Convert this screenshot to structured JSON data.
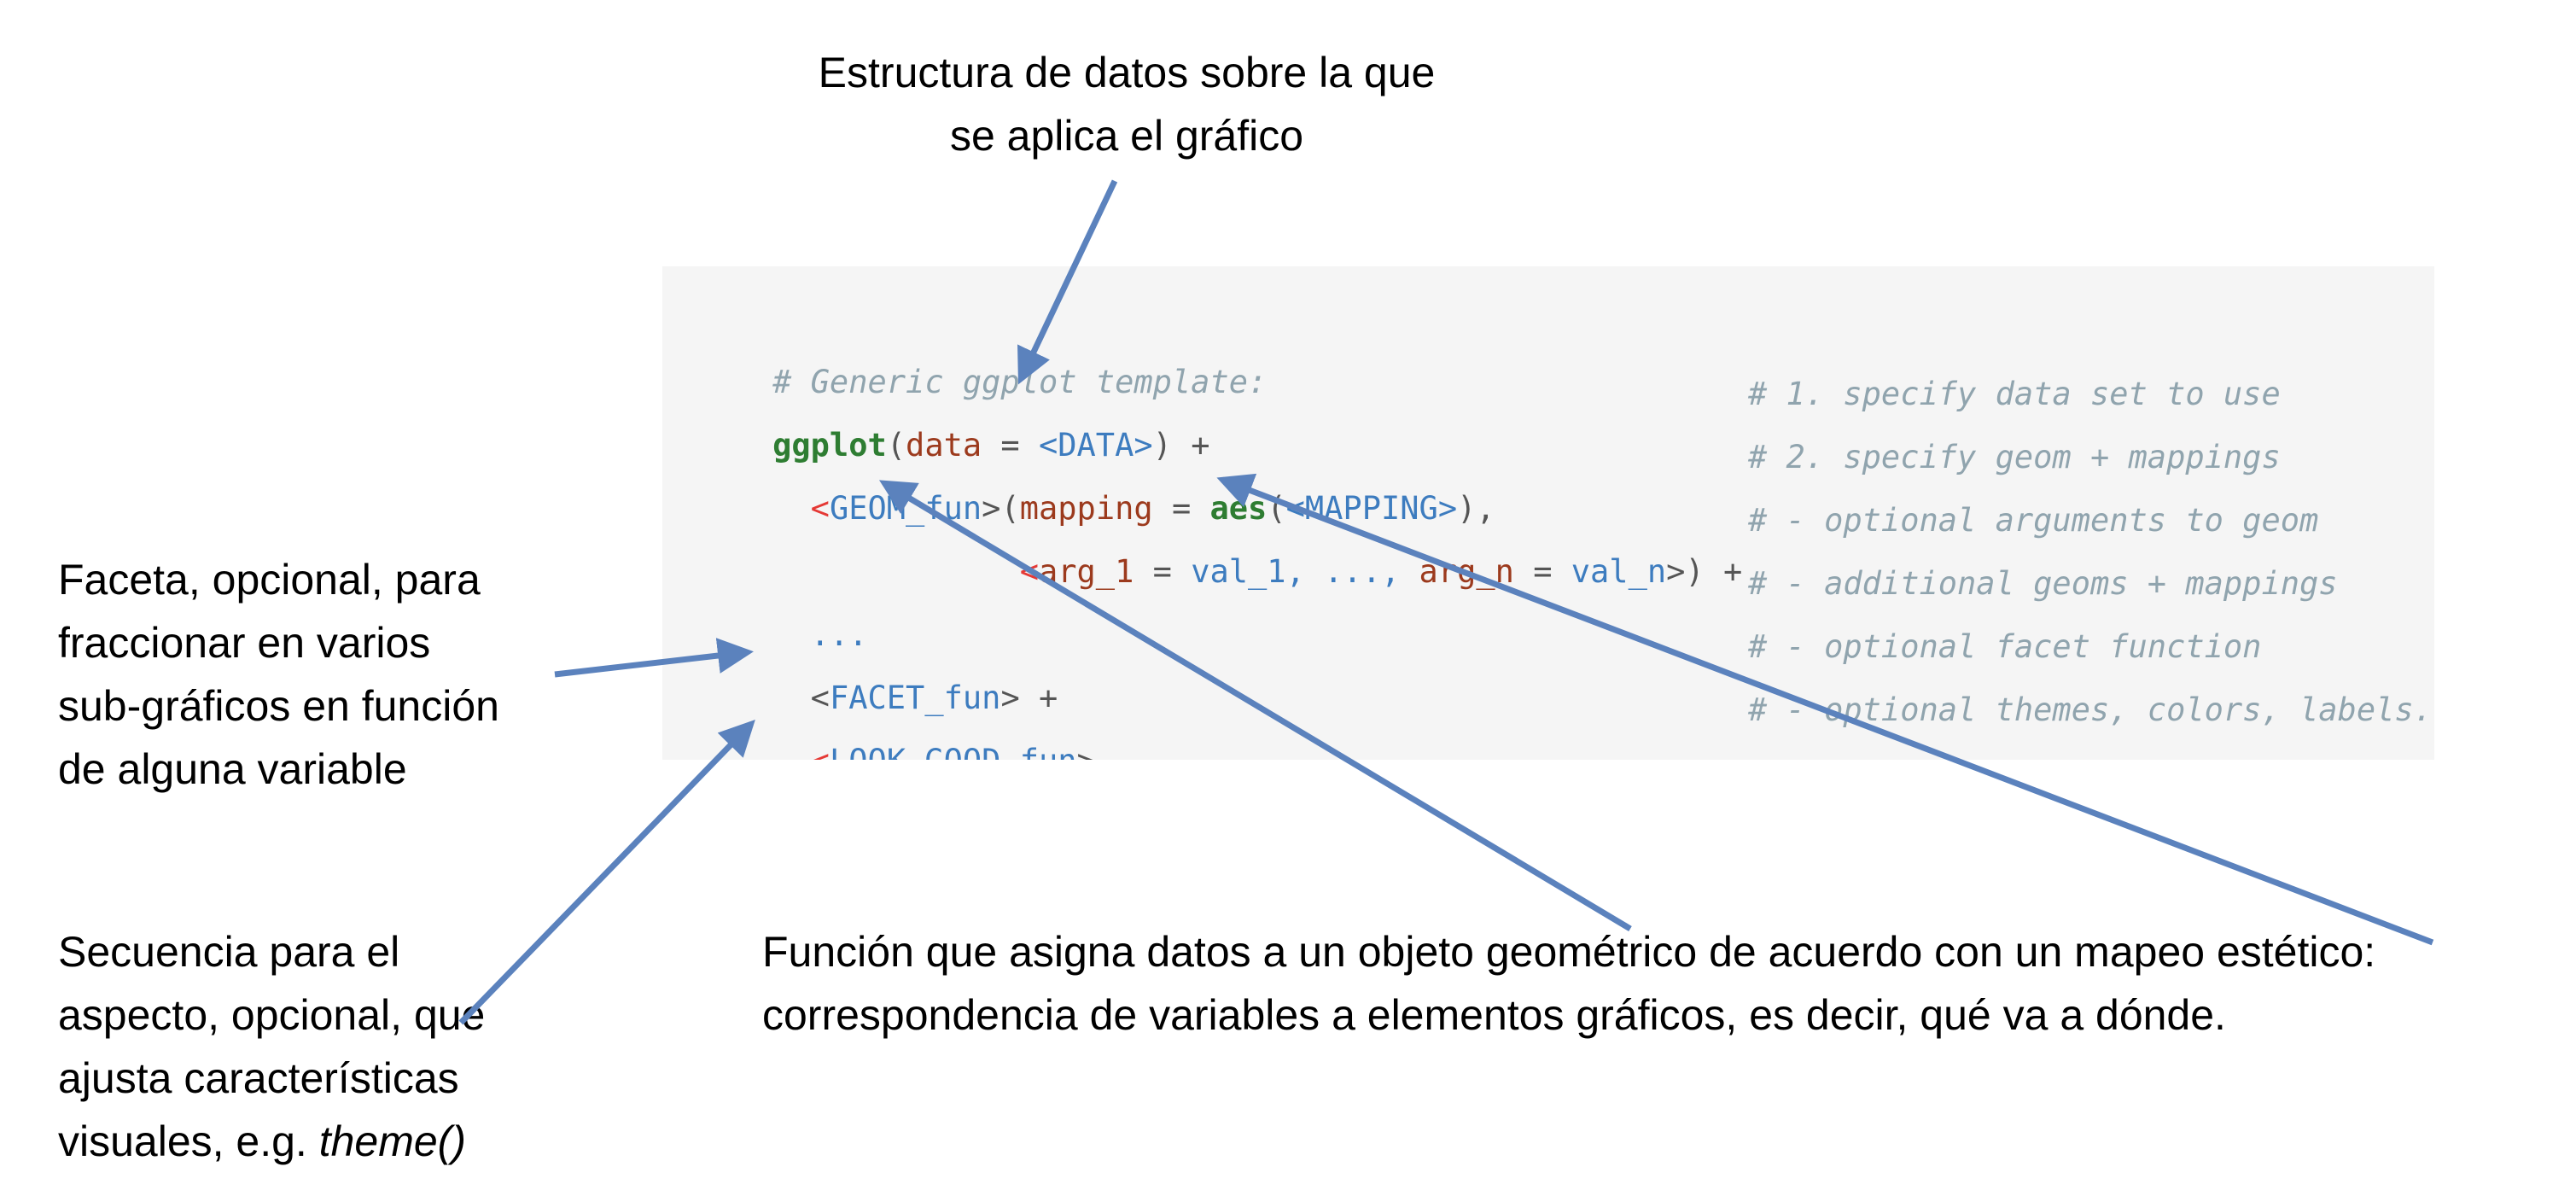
{
  "annotations": {
    "top": {
      "line1": "Estructura de datos sobre la que",
      "line2": "se aplica el gráfico"
    },
    "facet": {
      "line1": "Faceta, opcional, para",
      "line2": "fraccionar en varios",
      "line3": "sub-gráficos en función",
      "line4": "de alguna variable"
    },
    "look": {
      "line1": "Secuencia para el",
      "line2": "aspecto, opcional, que",
      "line3": "ajusta características",
      "line4_prefix": "visuales, e.g. ",
      "line4_italic": "theme()"
    },
    "geom": {
      "line1": "Función que asigna datos a un objeto geométrico de acuerdo con un mapeo estético:",
      "line2": "correspondencia de variables a elementos gráficos, es decir, qué va a dónde."
    }
  },
  "code": {
    "header_comment": "# Generic ggplot template:",
    "line1": {
      "func": "ggplot",
      "open": "(",
      "arg": "data",
      "eq": " = ",
      "ph": "<DATA>",
      "close": ") +"
    },
    "line2": {
      "lt": "<",
      "ph": "GEOM_fun",
      "gt": ">",
      "open": "(",
      "arg": "mapping",
      "eq": " = ",
      "func": "aes",
      "open2": "(",
      "ph2": "<MAPPING>",
      "close": "),",
      "indent": "  "
    },
    "line3": {
      "indent": "             ",
      "lt": "<",
      "arg1": "arg_1",
      "eq1": " = ",
      "val1": "val_1",
      "mid": ", ..., ",
      "argn": "arg_n",
      "eqn": " = ",
      "valn": "val_n",
      "close": ">) +"
    },
    "line4": {
      "indent": "  ",
      "dots": "..."
    },
    "line5": {
      "indent": "  ",
      "lt": "<",
      "ph": "FACET_fun",
      "gt": "> +"
    },
    "line6": {
      "indent": "  ",
      "lt": "<",
      "ph": "LOOK_GOOD_fun",
      "gt": ">"
    },
    "comments": [
      "# 1. specify data set to use",
      "# 2. specify geom + mappings",
      "# - optional arguments to geom",
      "# - additional geoms + mappings",
      "# - optional facet function",
      "# - optional themes, colors, labels..."
    ]
  },
  "colors": {
    "arrow": "#5b82bd",
    "code_background": "#f5f5f5",
    "comment": "#90a4ae",
    "function": "#2e7d32",
    "argument": "#9c3a1d",
    "placeholder": "#3d7cbf",
    "bracket_red": "#e53935"
  }
}
